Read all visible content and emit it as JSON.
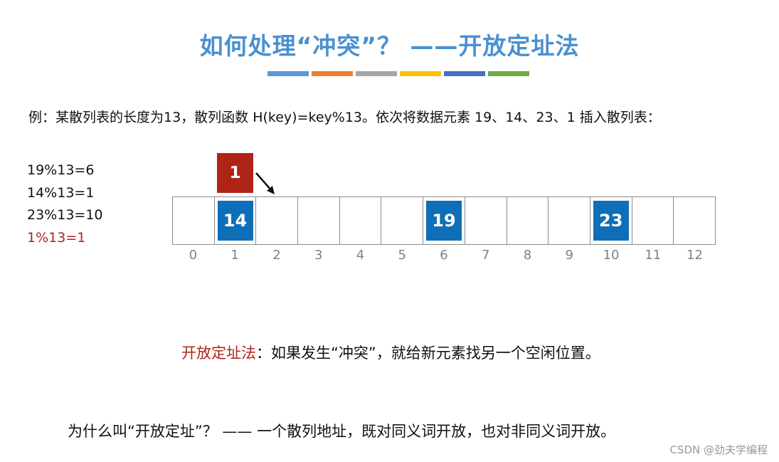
{
  "title": "如何处理“冲突”？ ——开放定址法",
  "color_bars": [
    "#5b9bd5",
    "#ed7d31",
    "#a5a5a5",
    "#ffc000",
    "#4472c4",
    "#70ad47"
  ],
  "example": "例：某散列表的长度为13，散列函数 H(key)=key%13。依次将数据元素 19、14、23、1 插入散列表：",
  "calculations": [
    {
      "text": "19%13=6"
    },
    {
      "text": "14%13=1"
    },
    {
      "text": "23%13=10"
    },
    {
      "text": "1%13=1"
    }
  ],
  "table": {
    "cells": [
      "",
      "14",
      "",
      "",
      "",
      "",
      "19",
      "",
      "",
      "",
      "23",
      "",
      ""
    ],
    "indices": [
      "0",
      "1",
      "2",
      "3",
      "4",
      "5",
      "6",
      "7",
      "8",
      "9",
      "10",
      "11",
      "12"
    ]
  },
  "new_element": "1",
  "definition": {
    "term": "开放定址法",
    "text": "：如果发生“冲突”，就给新元素找另一个空闲位置。"
  },
  "question": "为什么叫“开放定址”？ —— 一个散列地址，既对同义词开放，也对非同义词开放。",
  "credit": "CSDN @劲夫学编程",
  "colors": {
    "title": "#4a90d0",
    "box": "#0e6fb8",
    "highlight": "#b02418"
  }
}
